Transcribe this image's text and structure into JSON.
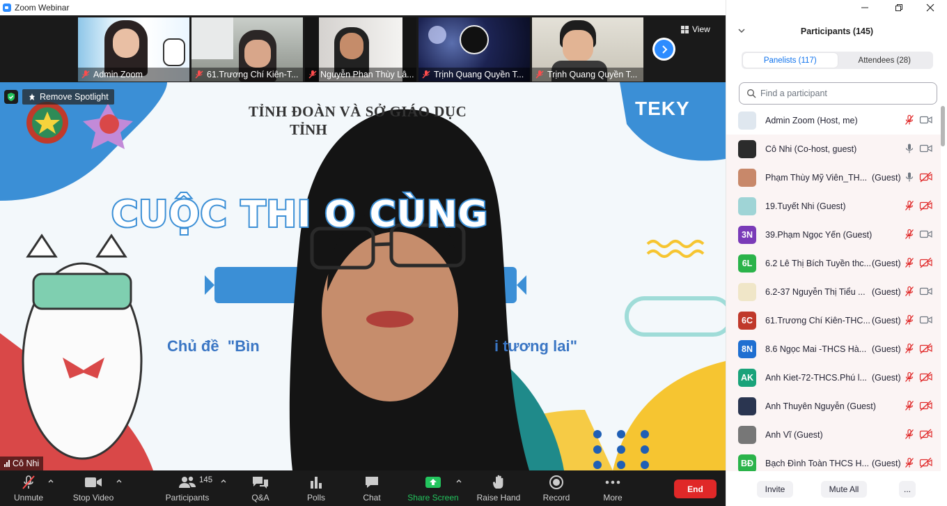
{
  "window": {
    "title": "Zoom Webinar",
    "icon": "zoom-camera-icon"
  },
  "strip": {
    "view_label": "View",
    "thumbs": [
      {
        "name": "Admin Zoom"
      },
      {
        "name": "61.Trương Chí Kiên-T..."
      },
      {
        "name": "Nguyễn Phan Thùy Lâ..."
      },
      {
        "name": "Trịnh Quang Quyền T..."
      },
      {
        "name": "Trịnh Quang Quyền T..."
      }
    ]
  },
  "main": {
    "remove_spotlight": "Remove Spotlight",
    "banner_line1": "TỈNH ĐOÀN VÀ SỞ GIÁO DỤC",
    "banner_line2": "TỈNH",
    "big_title": "CUỘC THI          O CÙNG",
    "subtitle_left": "Chủ đề  \"Bìn",
    "subtitle_right": "i tương lai\"",
    "brand": "TEKY",
    "speaker_name": "Cô Nhi"
  },
  "toolbar": {
    "unmute": "Unmute",
    "stop_video": "Stop Video",
    "participants": "Participants",
    "participants_count": "145",
    "qa": "Q&A",
    "polls": "Polls",
    "chat": "Chat",
    "share_screen": "Share Screen",
    "raise_hand": "Raise Hand",
    "record": "Record",
    "more": "More",
    "end": "End",
    "colors": {
      "end": "#e02828",
      "share": "#23c55e"
    }
  },
  "panel": {
    "title": "Participants (145)",
    "tab_panelists": "Panelists (117)",
    "tab_attendees": "Attendees (28)",
    "search_placeholder": "Find a participant",
    "invite": "Invite",
    "mute_all": "Mute All",
    "more": "...",
    "participants": [
      {
        "name": "Admin Zoom (Host, me)",
        "role": "",
        "initials": "",
        "avatar_color": "#dfe7ef",
        "mic": "muted",
        "video": "on",
        "highlight": false
      },
      {
        "name": "Cô Nhi (Co-host, guest)",
        "role": "",
        "initials": "",
        "avatar_color": "#2b2b2b",
        "mic": "on",
        "video": "on",
        "highlight": true
      },
      {
        "name": "Phạm Thùy Mỹ Viên_TH...",
        "role": "(Guest)",
        "initials": "",
        "avatar_color": "#c8886a",
        "mic": "on",
        "video": "off",
        "highlight": true
      },
      {
        "name": "19.Tuyết Nhi (Guest)",
        "role": "",
        "initials": "",
        "avatar_color": "#9fd4d6",
        "mic": "muted",
        "video": "off",
        "highlight": true
      },
      {
        "name": "39.Phạm Ngọc Yến (Guest)",
        "role": "",
        "initials": "3N",
        "avatar_color": "#7a3bb8",
        "mic": "muted",
        "video": "on",
        "highlight": true
      },
      {
        "name": "6.2 Lê Thị Bích Tuyền thc...",
        "role": "(Guest)",
        "initials": "6L",
        "avatar_color": "#2bb34a",
        "mic": "muted",
        "video": "off",
        "highlight": true
      },
      {
        "name": "6.2-37 Nguyễn Thị Tiểu ...",
        "role": "(Guest)",
        "initials": "",
        "avatar_color": "#f0e6c8",
        "mic": "muted",
        "video": "on",
        "highlight": true
      },
      {
        "name": "61.Trương Chí Kiên-THC...",
        "role": "(Guest)",
        "initials": "6C",
        "avatar_color": "#c0392b",
        "mic": "muted",
        "video": "on",
        "highlight": true
      },
      {
        "name": "8.6 Ngọc Mai -THCS Hà...",
        "role": "(Guest)",
        "initials": "8N",
        "avatar_color": "#1f6fd1",
        "mic": "muted",
        "video": "off",
        "highlight": true
      },
      {
        "name": "Anh Kiet-72-THCS.Phú l...",
        "role": "(Guest)",
        "initials": "AK",
        "avatar_color": "#1aa37a",
        "mic": "muted",
        "video": "off",
        "highlight": true
      },
      {
        "name": "Anh Thuyên Nguyễn (Guest)",
        "role": "",
        "initials": "",
        "avatar_color": "#2a3550",
        "mic": "muted",
        "video": "off",
        "highlight": true
      },
      {
        "name": "Anh Vĩ (Guest)",
        "role": "",
        "initials": "",
        "avatar_color": "#777777",
        "mic": "muted",
        "video": "off",
        "highlight": true
      },
      {
        "name": "Bạch Đình Toàn THCS H...",
        "role": "(Guest)",
        "initials": "BĐ",
        "avatar_color": "#2bb34a",
        "mic": "muted",
        "video": "off",
        "highlight": true
      }
    ]
  }
}
